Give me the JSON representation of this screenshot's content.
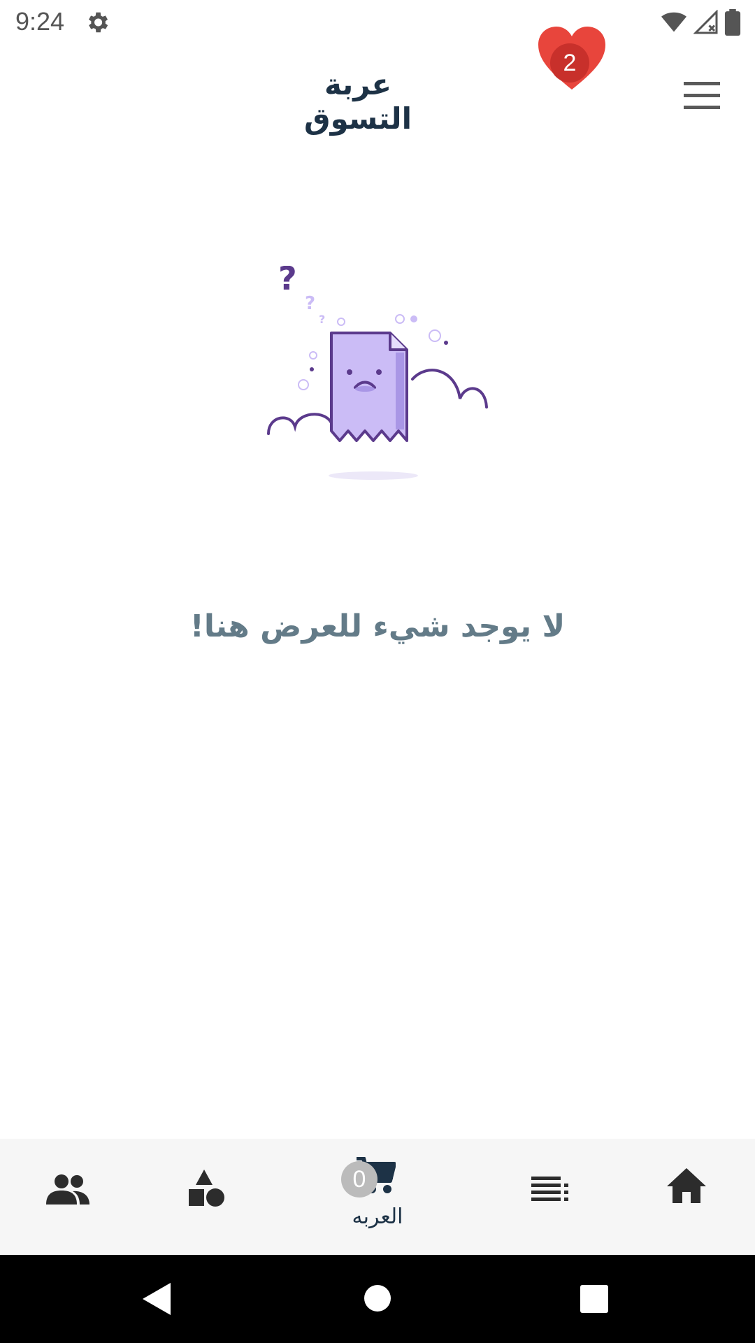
{
  "status_bar": {
    "time": "9:24",
    "icons": [
      "settings-icon",
      "wifi-icon",
      "signal-icon",
      "battery-icon"
    ]
  },
  "app_bar": {
    "title": "عربة التسوق",
    "favorites_count": "2",
    "favorites_icon": "heart-icon",
    "menu_icon": "hamburger-menu-icon"
  },
  "empty_state": {
    "illustration": "sad-document-icon",
    "message": "لا يوجد شيء للعرض هنا!"
  },
  "bottom_nav": {
    "items": [
      {
        "icon": "people-icon",
        "label": ""
      },
      {
        "icon": "shapes-icon",
        "label": ""
      },
      {
        "icon": "cart-icon",
        "label": "العربه",
        "badge": "0",
        "active": true
      },
      {
        "icon": "list-icon",
        "label": ""
      },
      {
        "icon": "home-icon",
        "label": ""
      }
    ]
  },
  "colors": {
    "title": "#1d3246",
    "message": "#637b88",
    "heart": "#e8453c",
    "badge_fav": "#c8302b",
    "cart_badge": "#bbbbbb",
    "illustration_fill": "#cbbcf6",
    "illustration_stroke": "#5b3a8c",
    "nav_background": "#f6f6f6"
  },
  "system_nav": {
    "icons": [
      "back-icon",
      "home-circle-icon",
      "recents-icon"
    ]
  }
}
